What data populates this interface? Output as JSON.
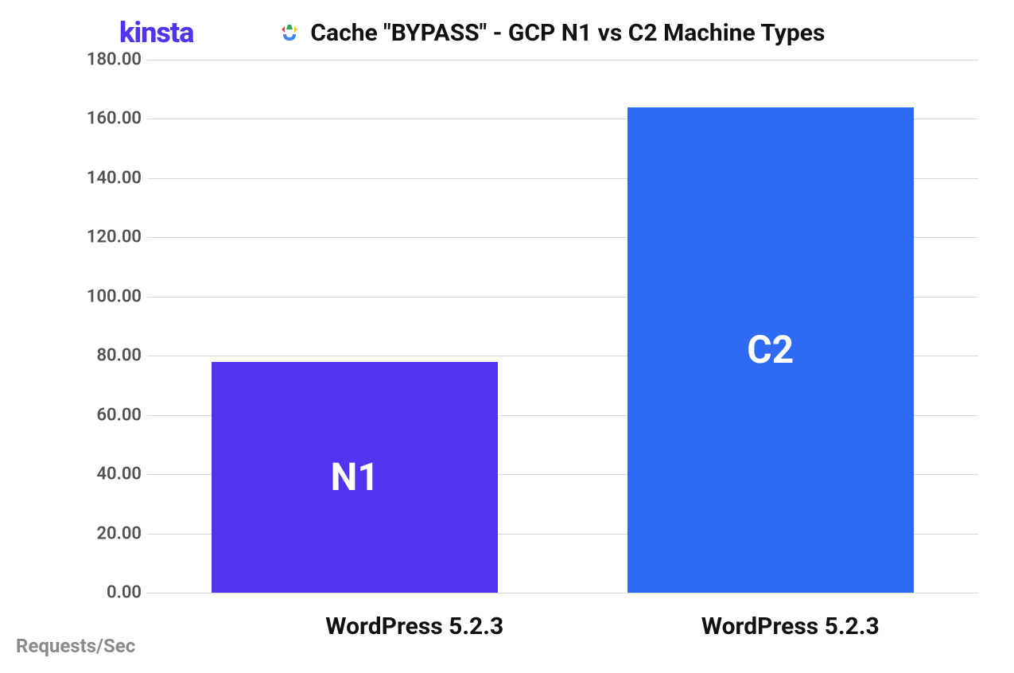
{
  "header": {
    "logo": "kinsta",
    "title": "Cache \"BYPASS\" - GCP N1 vs C2 Machine Types"
  },
  "chart_data": {
    "type": "bar",
    "categories": [
      "WordPress 5.2.3",
      "WordPress 5.2.3"
    ],
    "series": [
      {
        "name": "N1",
        "value": 78,
        "color": "#5333ed"
      },
      {
        "name": "C2",
        "value": 164,
        "color": "#2f6bf2"
      }
    ],
    "ylabel": "Requests/Sec",
    "ylim": [
      0,
      180
    ],
    "yticks": [
      "0.00",
      "20.00",
      "40.00",
      "60.00",
      "80.00",
      "100.00",
      "120.00",
      "140.00",
      "160.00",
      "180.00"
    ]
  }
}
